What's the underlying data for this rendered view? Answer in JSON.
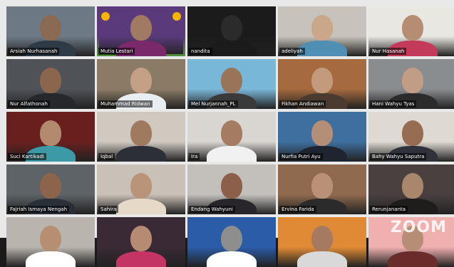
{
  "window": {
    "brand_watermark": "ZOOM",
    "columns": 5,
    "rows": 5
  },
  "participants": [
    {
      "name": "Arsiah Nurhasanah",
      "bg": "#6d7a86",
      "skin": "#8a6a52",
      "shirt": "#2e3a45",
      "active": false
    },
    {
      "name": "Mutia Lestari",
      "bg": "#5a3a7a",
      "skin": "#a07a62",
      "shirt": "#7a2a6a",
      "active": true
    },
    {
      "name": "nandita",
      "bg": "#1b1b1b",
      "skin": "#2b2b2b",
      "shirt": "#1b1b1b",
      "active": false
    },
    {
      "name": "adeliyah",
      "bg": "#c7c2bb",
      "skin": "#caa68a",
      "shirt": "#4e8fb3",
      "active": false
    },
    {
      "name": "Nur Hasanah",
      "bg": "#e9e7e2",
      "skin": "#b58d72",
      "shirt": "#c43a5a",
      "active": false
    },
    {
      "name": "Nur Alfathonah",
      "bg": "#4f5358",
      "skin": "#8b654c",
      "shirt": "#26282b",
      "active": false
    },
    {
      "name": "Muhammad Ridwan",
      "bg": "#8b7b66",
      "skin": "#c4a087",
      "shirt": "#e9eef2",
      "active": false
    },
    {
      "name": "Mel Nurjannah_PL",
      "bg": "#79b7d8",
      "skin": "#9a7458",
      "shirt": "#3a3a3a",
      "active": false
    },
    {
      "name": "Fikhan Andiawan",
      "bg": "#a56a3e",
      "skin": "#c49a7c",
      "shirt": "#4b3a2f",
      "active": false
    },
    {
      "name": "Hani Wahyu Tyas",
      "bg": "#8a8d8f",
      "skin": "#c29d86",
      "shirt": "#2b2b2b",
      "active": false
    },
    {
      "name": "Suci Kartikadi",
      "bg": "#6a1f1f",
      "skin": "#b48a6e",
      "shirt": "#3b9aa5",
      "active": false
    },
    {
      "name": "Iqbal",
      "bg": "#cfc9c0",
      "skin": "#9f7a5e",
      "shirt": "#2c3036",
      "active": false
    },
    {
      "name": "Ira",
      "bg": "#d9d6d1",
      "skin": "#a57c61",
      "shirt": "#f1f1f1",
      "active": false
    },
    {
      "name": "Nurfia Putri Ayu",
      "bg": "#3f6f9f",
      "skin": "#b48e76",
      "shirt": "#1e2430",
      "active": false
    },
    {
      "name": "Bahy Wahyu Saputra",
      "bg": "#ded9d2",
      "skin": "#966d52",
      "shirt": "#30323a",
      "active": false
    },
    {
      "name": "Fajriah Ismaya Nengah",
      "bg": "#5d6366",
      "skin": "#8b644b",
      "shirt": "#293038",
      "active": false
    },
    {
      "name": "Sahira",
      "bg": "#c9c1b7",
      "skin": "#ba9478",
      "shirt": "#e7d9c7",
      "active": false
    },
    {
      "name": "Endang Wahyuni",
      "bg": "#c3c0bc",
      "skin": "#8b5f4a",
      "shirt": "#28262a",
      "active": false
    },
    {
      "name": "Ervina Farida",
      "bg": "#8f6a4f",
      "skin": "#b99177",
      "shirt": "#2b2b2b",
      "active": false
    },
    {
      "name": "Rerunjananta",
      "bg": "#4a4040",
      "skin": "#a8876d",
      "shirt": "#1f1c1c",
      "active": false
    },
    {
      "name": "",
      "bg": "#b9b4ad",
      "skin": "#b68e72",
      "shirt": "#ffffff",
      "active": false
    },
    {
      "name": "",
      "bg": "#3a2a35",
      "skin": "#b58b73",
      "shirt": "#c43464",
      "active": false
    },
    {
      "name": "",
      "bg": "#2a5ca8",
      "skin": "#8e8e8e",
      "shirt": "#ffffff",
      "active": false
    },
    {
      "name": "",
      "bg": "#e08a35",
      "skin": "#a57a61",
      "shirt": "#d9d9d9",
      "active": false
    },
    {
      "name": "",
      "bg": "#f0b0b0",
      "skin": "#b68e76",
      "shirt": "#6a2b2b",
      "active": false
    }
  ]
}
